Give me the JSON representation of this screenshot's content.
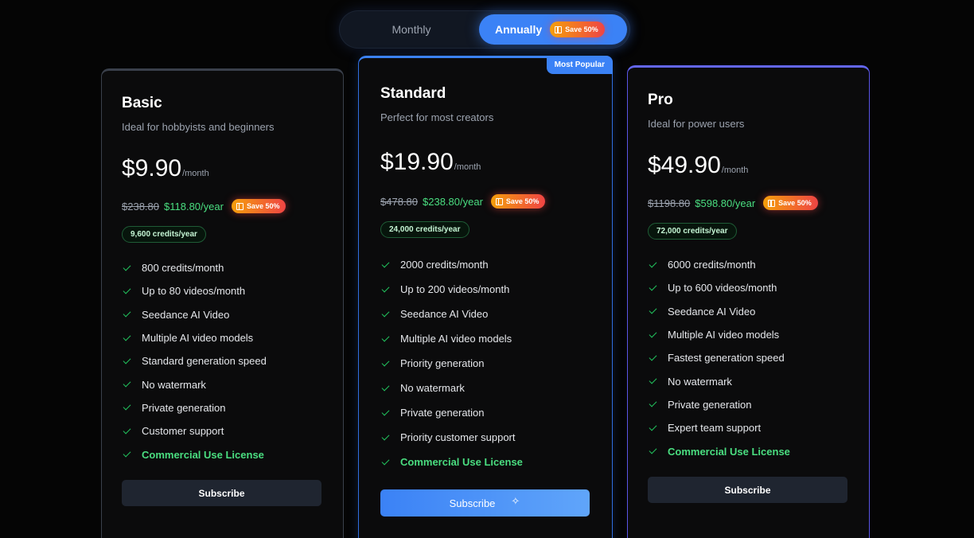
{
  "toggle": {
    "monthly_label": "Monthly",
    "annually_label": "Annually",
    "save_label": "Save 50%",
    "selected": "Annually"
  },
  "plans": [
    {
      "name": "Basic",
      "description": "Ideal for hobbyists and beginners",
      "price": "$9.90",
      "per": "/month",
      "old_yearly": "$238.80",
      "new_yearly": "$118.80/year",
      "save_label": "Save 50%",
      "credits": "9,600 credits/year",
      "features": [
        "800 credits/month",
        "Up to 80 videos/month",
        "Seedance AI Video",
        "Multiple AI video models",
        "Standard generation speed",
        "No watermark",
        "Private generation",
        "Customer support",
        "Commercial Use License"
      ],
      "button_label": "Subscribe"
    },
    {
      "name": "Standard",
      "badge": "Most Popular",
      "description": "Perfect for most creators",
      "price": "$19.90",
      "per": "/month",
      "old_yearly": "$478.80",
      "new_yearly": "$238.80/year",
      "save_label": "Save 50%",
      "credits": "24,000 credits/year",
      "features": [
        "2000 credits/month",
        "Up to 200 videos/month",
        "Seedance AI Video",
        "Multiple AI video models",
        "Priority generation",
        "No watermark",
        "Private generation",
        "Priority customer support",
        "Commercial Use License"
      ],
      "button_label": "Subscribe"
    },
    {
      "name": "Pro",
      "description": "Ideal for power users",
      "price": "$49.90",
      "per": "/month",
      "old_yearly": "$1198.80",
      "new_yearly": "$598.80/year",
      "save_label": "Save 50%",
      "credits": "72,000 credits/year",
      "features": [
        "6000 credits/month",
        "Up to 600 videos/month",
        "Seedance AI Video",
        "Multiple AI video models",
        "Fastest generation speed",
        "No watermark",
        "Private generation",
        "Expert team support",
        "Commercial Use License"
      ],
      "button_label": "Subscribe"
    }
  ],
  "colors": {
    "accent": "#3b82f6",
    "pro_accent": "#6366f1",
    "success": "#4ade80",
    "save_gradient_start": "#f59e0b",
    "save_gradient_end": "#ef4444"
  },
  "icons": {
    "check": "check-icon",
    "gift": "gift-icon",
    "sparkle": "sparkle-icon"
  }
}
